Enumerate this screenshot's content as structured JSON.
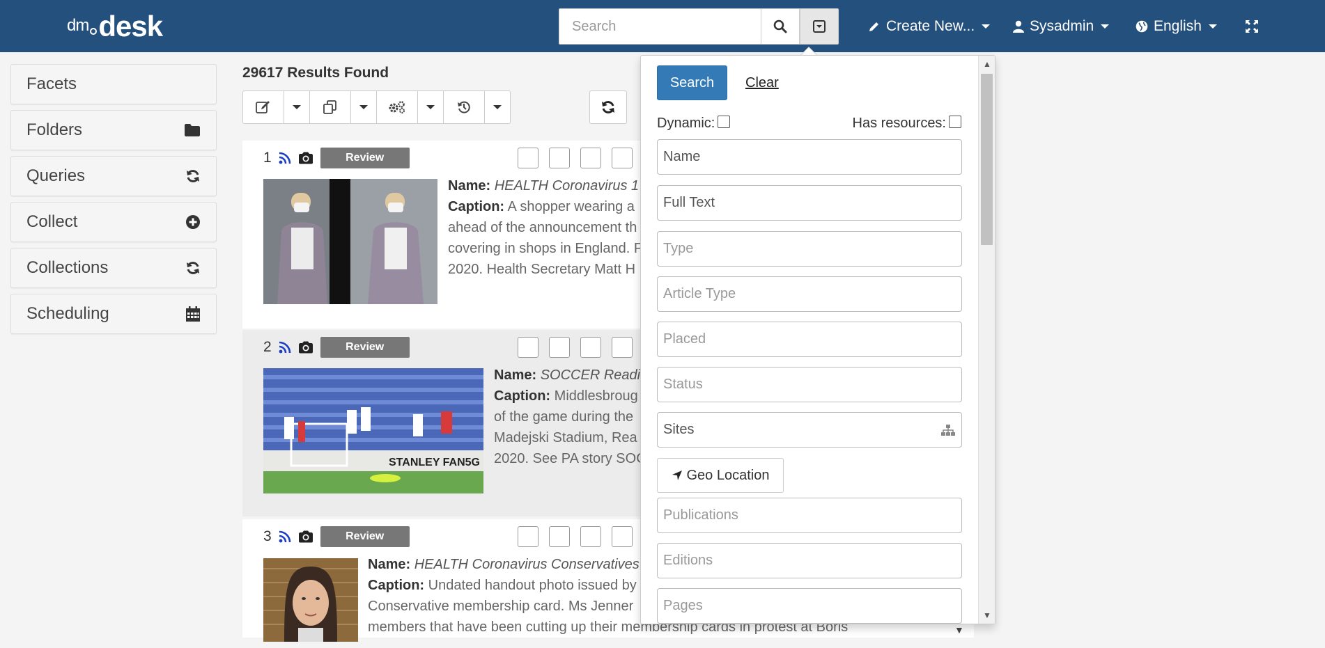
{
  "app": {
    "logo_prefix": "dm",
    "logo_name": "desk"
  },
  "navbar": {
    "search_placeholder": "Search",
    "create_label": "Create New...",
    "user_label": "Sysadmin",
    "language_label": "English"
  },
  "sidebar": {
    "items": [
      {
        "label": "Facets",
        "icon": ""
      },
      {
        "label": "Folders",
        "icon": "folder-icon"
      },
      {
        "label": "Queries",
        "icon": "refresh-icon"
      },
      {
        "label": "Collect",
        "icon": "plus-circle-icon"
      },
      {
        "label": "Collections",
        "icon": "refresh-icon"
      },
      {
        "label": "Scheduling",
        "icon": "calendar-icon"
      }
    ]
  },
  "results": {
    "count_label": "29617 Results Found",
    "items": [
      {
        "index": "1",
        "badge": "Review",
        "name_label": "Name:",
        "name_value": "HEALTH Coronavirus 1",
        "caption_label": "Caption:",
        "caption_lines": [
          "A shopper wearing a",
          "ahead of the announcement th",
          "covering in shops in England. P",
          "2020. Health Secretary Matt H"
        ]
      },
      {
        "index": "2",
        "badge": "Review",
        "name_label": "Name:",
        "name_value": "SOCCER Readi",
        "caption_label": "Caption:",
        "caption_lines": [
          "Middlesbroug",
          "of the game during the",
          "Madejski Stadium, Rea",
          "2020. See PA story SOC"
        ]
      },
      {
        "index": "3",
        "badge": "Review",
        "name_label": "Name:",
        "name_value": "HEALTH Coronavirus Conservatives",
        "caption_label": "Caption:",
        "caption_lines": [
          "Undated handout photo issued by",
          "Conservative membership card. Ms Jenner",
          "members that have been cutting up their membership cards in protest at Boris"
        ]
      }
    ]
  },
  "search_panel": {
    "search_button": "Search",
    "clear_link": "Clear",
    "dynamic_label": "Dynamic:",
    "has_resources_label": "Has resources:",
    "fields": {
      "name": "Name",
      "full_text": "Full Text",
      "type": "Type",
      "article_type": "Article Type",
      "placed": "Placed",
      "status": "Status",
      "sites": "Sites",
      "publications": "Publications",
      "editions": "Editions",
      "pages": "Pages"
    },
    "geo_location_button": "Geo Location"
  },
  "colors": {
    "navbar": "#24507e",
    "primary_button": "#337ab7",
    "review_badge": "#777777",
    "rss_icon": "#1a3fc4"
  }
}
